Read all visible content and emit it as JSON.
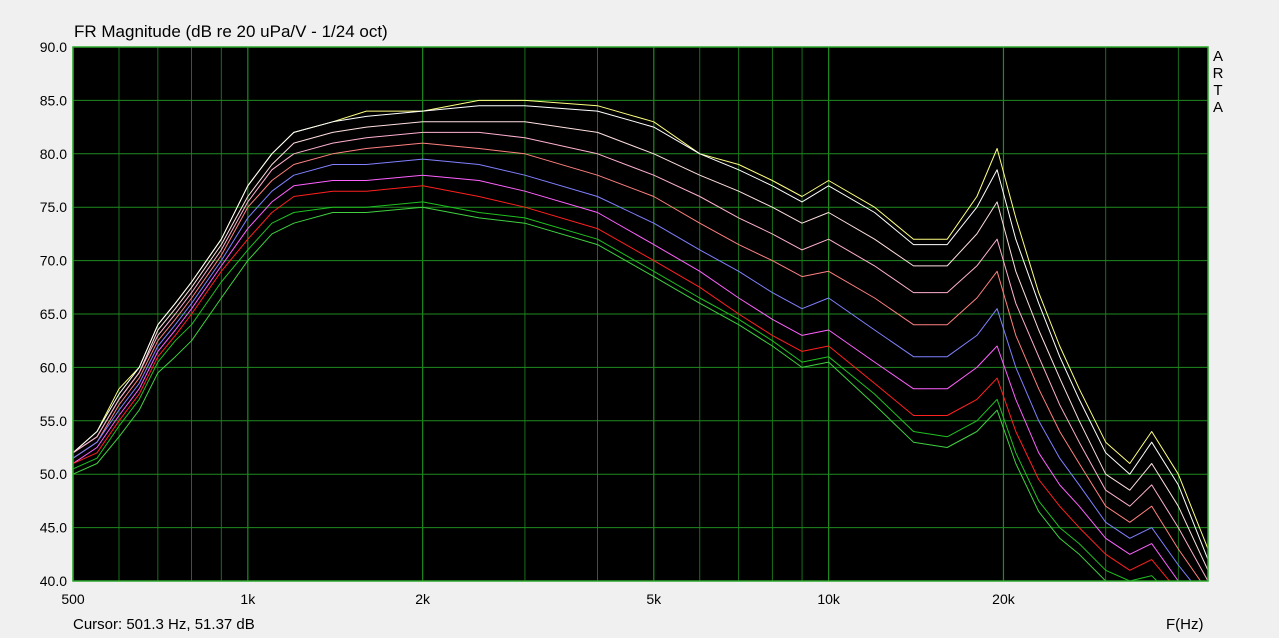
{
  "cursor_text": "Cursor: 501.3 Hz, 51.37 dB",
  "watermark_letters": [
    "A",
    "R",
    "T",
    "A"
  ],
  "colors": {
    "plot_background": "#000000",
    "grid": "#1f8a1f",
    "frame": "#2aa82a"
  },
  "chart_data": {
    "type": "line",
    "title": "FR Magnitude (dB re 20 uPa/V - 1/24 oct)",
    "xlabel": "F(Hz)",
    "ylabel": "",
    "xscale": "log",
    "xlim": [
      500,
      45000
    ],
    "ylim": [
      40,
      90
    ],
    "x_ticks": [
      500,
      1000,
      2000,
      5000,
      10000,
      20000
    ],
    "x_tick_labels": [
      "500",
      "1k",
      "2k",
      "5k",
      "10k",
      "20k"
    ],
    "y_ticks": [
      40,
      45,
      50,
      55,
      60,
      65,
      70,
      75,
      80,
      85,
      90
    ],
    "y_tick_labels": [
      "40.0",
      "45.0",
      "50.0",
      "55.0",
      "60.0",
      "65.0",
      "70.0",
      "75.0",
      "80.0",
      "85.0",
      "90.0"
    ],
    "grid": true,
    "x": [
      500,
      550,
      600,
      650,
      700,
      750,
      800,
      900,
      1000,
      1100,
      1200,
      1400,
      1600,
      2000,
      2500,
      3000,
      4000,
      5000,
      6000,
      7000,
      8000,
      9000,
      10000,
      12000,
      14000,
      16000,
      18000,
      19500,
      21000,
      23000,
      25000,
      27000,
      30000,
      33000,
      36000,
      40000,
      45000
    ],
    "series": [
      {
        "color": "#ffff80",
        "values": [
          52,
          54,
          58,
          60,
          64,
          66,
          68,
          72,
          77,
          80,
          82,
          83,
          84,
          84,
          85,
          85,
          84.5,
          83,
          80,
          79,
          77.5,
          76,
          77.5,
          75,
          72,
          72,
          76,
          80.5,
          74,
          67,
          62,
          58,
          53,
          51,
          54,
          50,
          43
        ]
      },
      {
        "color": "#ffffff",
        "values": [
          52,
          54,
          57.5,
          60,
          64,
          66,
          68,
          72,
          77,
          80,
          82,
          83,
          83.5,
          84,
          84.5,
          84.5,
          84,
          82.5,
          80,
          78.5,
          77,
          75.5,
          77,
          74.5,
          71.5,
          71.5,
          75,
          78.5,
          72,
          66,
          61,
          57,
          52,
          50,
          53,
          49,
          42
        ]
      },
      {
        "color": "#ffe0e0",
        "values": [
          52,
          53.5,
          57,
          59.5,
          63.5,
          65.5,
          67.5,
          71.5,
          76,
          79,
          81,
          82,
          82.5,
          83,
          83,
          83,
          82,
          80,
          78,
          76.5,
          75,
          73.5,
          74.5,
          72,
          69.5,
          69.5,
          72.5,
          75.5,
          69,
          63.5,
          59,
          55,
          50,
          48.5,
          51,
          47,
          41
        ]
      },
      {
        "color": "#ffb0d0",
        "values": [
          52,
          53.5,
          57,
          59.5,
          63,
          65,
          67,
          71,
          75.5,
          78.5,
          80,
          81,
          81.5,
          82,
          82,
          81.5,
          80,
          78,
          76,
          74,
          72.5,
          71,
          72,
          69.5,
          67,
          67,
          69.5,
          72,
          66,
          61,
          56.5,
          53,
          48.5,
          47,
          49,
          45,
          40
        ]
      },
      {
        "color": "#ff8080",
        "values": [
          51.5,
          53,
          56.5,
          59,
          62.5,
          64.5,
          66.5,
          70.5,
          75,
          77.5,
          79,
          80,
          80.5,
          81,
          80.5,
          80,
          78,
          76,
          73.5,
          71.5,
          70,
          68.5,
          69,
          66.5,
          64,
          64,
          66.5,
          69,
          63,
          58,
          54,
          51,
          47,
          45.5,
          47,
          43,
          39
        ]
      },
      {
        "color": "#8080ff",
        "values": [
          51.5,
          53,
          56,
          58.5,
          62,
          64,
          66,
          70,
          74,
          76.5,
          78,
          79,
          79,
          79.5,
          79,
          78,
          76,
          73.5,
          71,
          69,
          67,
          65.5,
          66.5,
          63.5,
          61,
          61,
          63,
          65.5,
          60,
          55,
          51.5,
          49,
          45.5,
          44,
          45,
          41.5,
          38
        ]
      },
      {
        "color": "#ff60ff",
        "values": [
          51,
          52.5,
          55.5,
          58,
          61.5,
          63.5,
          65.5,
          69.5,
          73,
          75.5,
          77,
          77.5,
          77.5,
          78,
          77.5,
          76.5,
          74.5,
          71.5,
          69,
          66.5,
          64.5,
          63,
          63.5,
          60.5,
          58,
          58,
          60,
          62,
          57,
          52,
          49,
          47,
          44,
          42.5,
          43.5,
          40,
          37
        ]
      },
      {
        "color": "#ff2020",
        "values": [
          51,
          52,
          55,
          57.5,
          61,
          63,
          65,
          69,
          72,
          74.5,
          76,
          76.5,
          76.5,
          77,
          76,
          75,
          73,
          70,
          67.5,
          65,
          63,
          61.5,
          62,
          58.5,
          55.5,
          55.5,
          57,
          59,
          54,
          49.5,
          47,
          45,
          42.5,
          41,
          42,
          39,
          36
        ]
      },
      {
        "color": "#20c020",
        "values": [
          50.5,
          51.5,
          54.5,
          57,
          60.5,
          62.5,
          64,
          68,
          71,
          73.5,
          74.5,
          75,
          75,
          75.5,
          74.5,
          74,
          72,
          69,
          66.5,
          64.5,
          62.5,
          60.5,
          61,
          57.5,
          54,
          53.5,
          55,
          57,
          52,
          47.5,
          45,
          43.5,
          41,
          40,
          40.5,
          38,
          35
        ]
      },
      {
        "color": "#40d040",
        "values": [
          50,
          51,
          53.5,
          56,
          59.5,
          61,
          62.5,
          66.5,
          70,
          72.5,
          73.5,
          74.5,
          74.5,
          75,
          74,
          73.5,
          71.5,
          68.5,
          66,
          64,
          62,
          60,
          60.5,
          56.5,
          53,
          52.5,
          54,
          56,
          51,
          46.5,
          44,
          42.5,
          40,
          39,
          39.5,
          37,
          34
        ]
      }
    ]
  }
}
